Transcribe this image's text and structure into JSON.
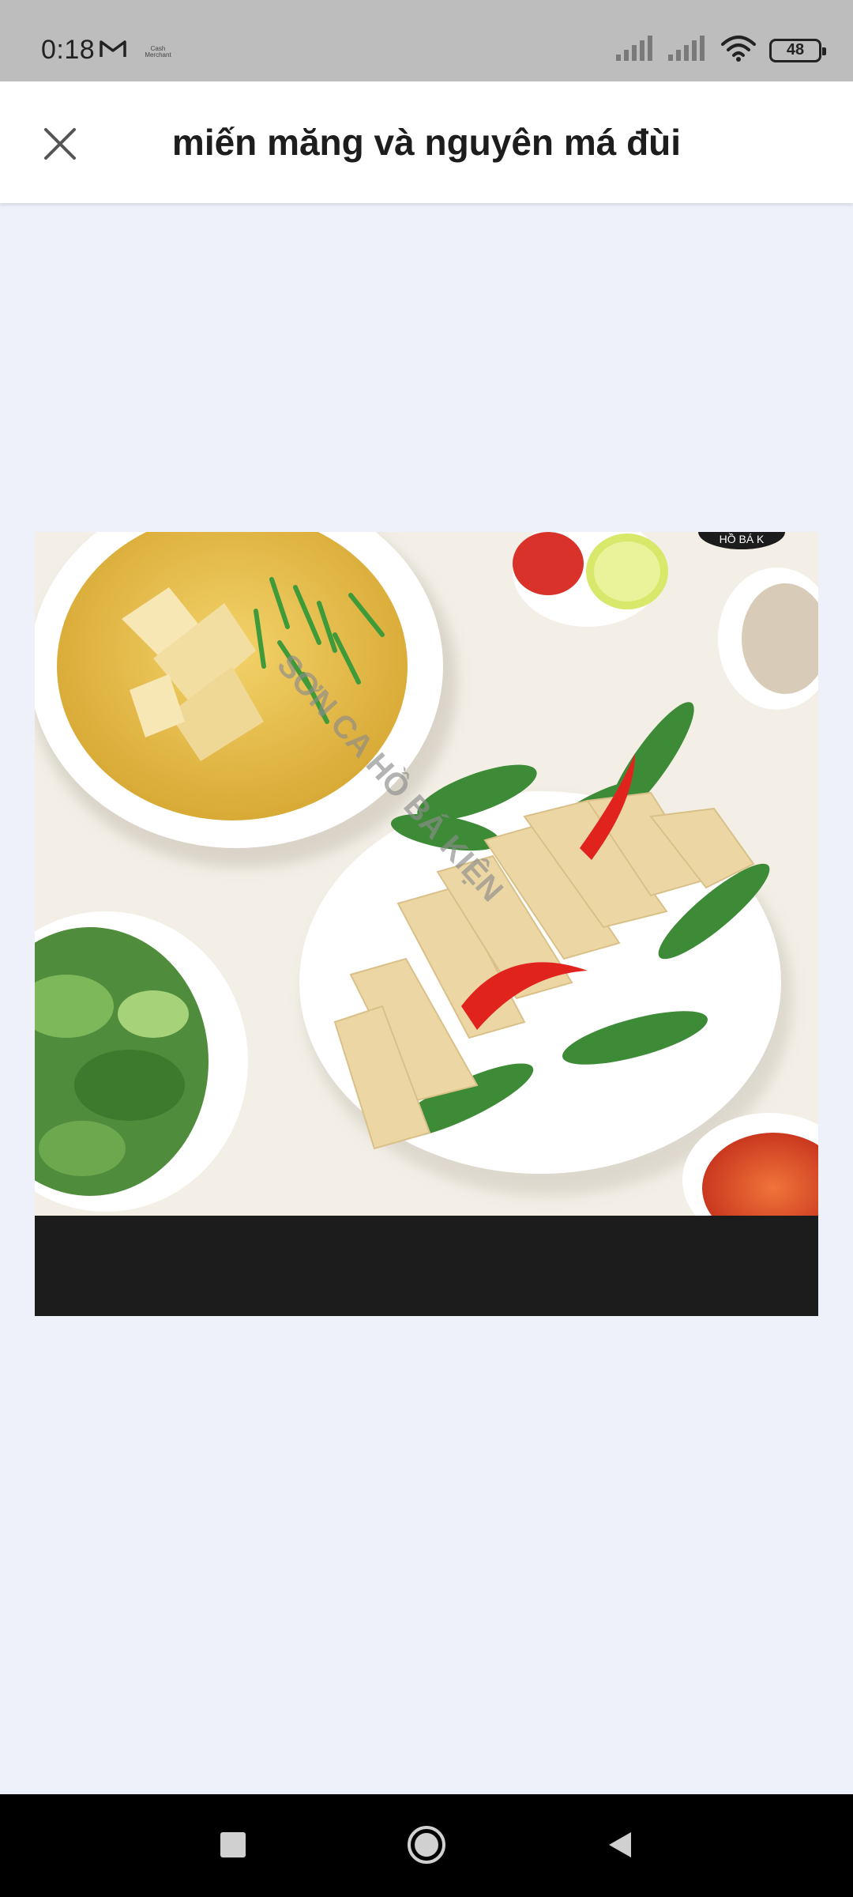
{
  "status_bar": {
    "time": "0:18",
    "notification_small_text": "Cash Merchant",
    "battery_level": "48",
    "icons": [
      "gmail-icon",
      "signal-icon",
      "signal-icon",
      "wifi-icon",
      "battery-icon"
    ]
  },
  "header": {
    "title": "miến măng và nguyên má đùi",
    "close_icon": "close-icon"
  },
  "image": {
    "watermark_text": "SƠN CA HỒ BÁ KIỆN",
    "badge_text": "HỒ BÁ K"
  },
  "nav_bar": {
    "icons": [
      "recents-icon",
      "home-icon",
      "back-icon"
    ]
  },
  "colors": {
    "status_bar_bg": "#bdbdbd",
    "header_bg": "#ffffff",
    "page_bg": "#eef1fa",
    "image_bottom_band": "#1c1c1c",
    "nav_bar_bg": "#000000"
  }
}
